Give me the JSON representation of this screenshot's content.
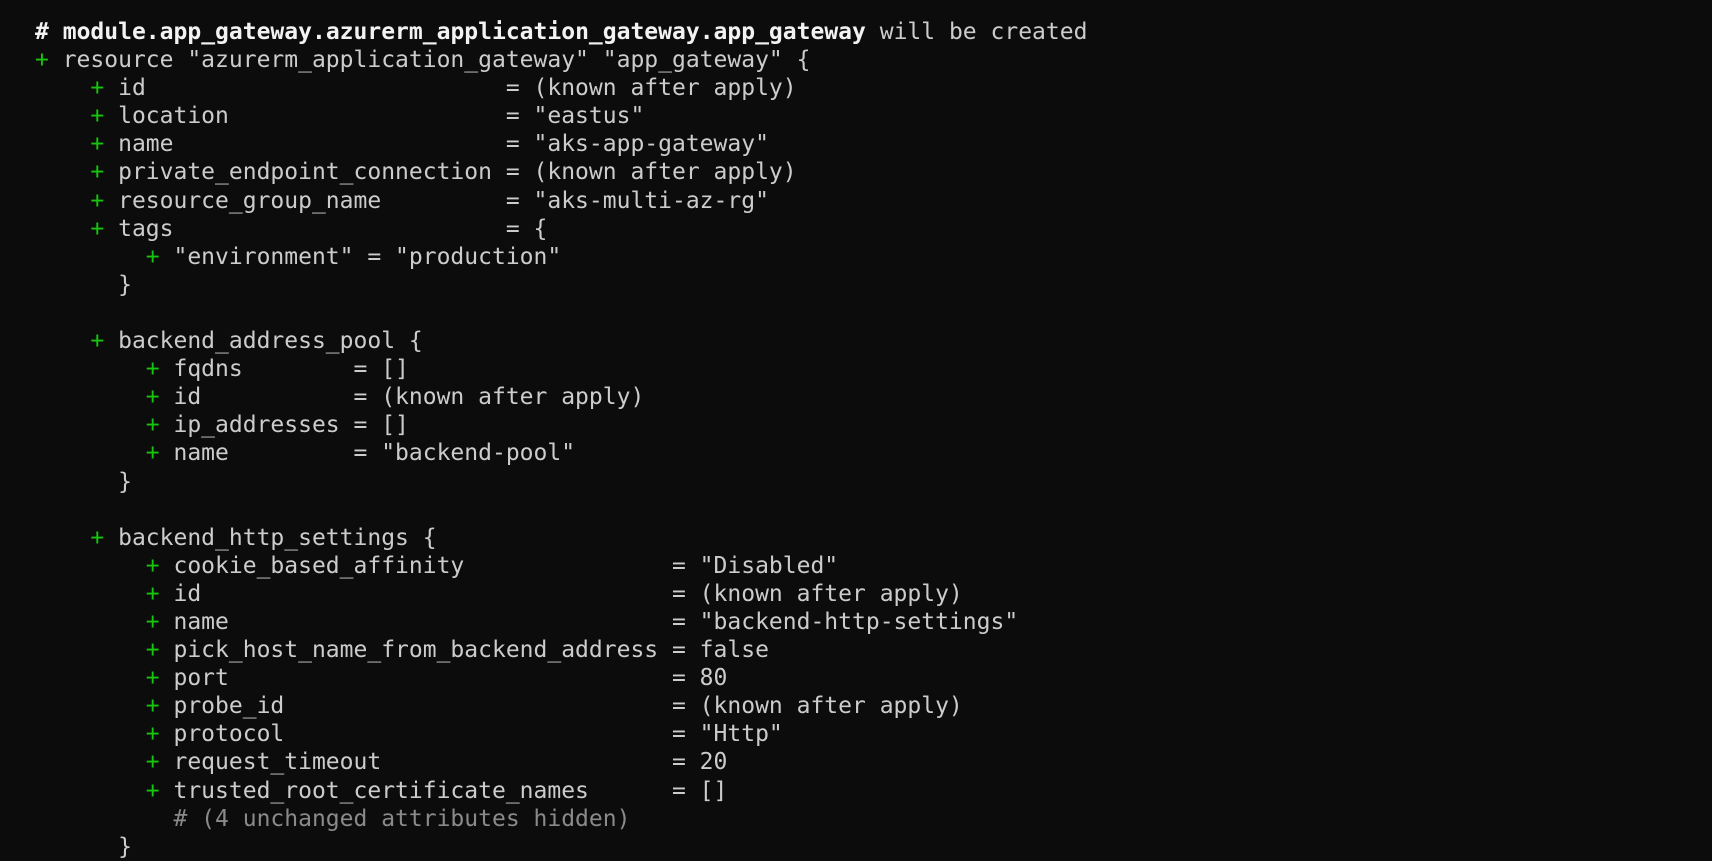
{
  "terminal": {
    "header": {
      "hash": "#",
      "address": "module.app_gateway.azurerm_application_gateway.app_gateway",
      "action": "will be created"
    },
    "lines": [
      {
        "indent": "",
        "plus": "+",
        "text": " resource \"azurerm_application_gateway\" \"app_gateway\" {"
      },
      {
        "indent": "    ",
        "plus": "+",
        "text": " id                          = (known after apply)"
      },
      {
        "indent": "    ",
        "plus": "+",
        "text": " location                    = \"eastus\""
      },
      {
        "indent": "    ",
        "plus": "+",
        "text": " name                        = \"aks-app-gateway\""
      },
      {
        "indent": "    ",
        "plus": "+",
        "text": " private_endpoint_connection = (known after apply)"
      },
      {
        "indent": "    ",
        "plus": "+",
        "text": " resource_group_name         = \"aks-multi-az-rg\""
      },
      {
        "indent": "    ",
        "plus": "+",
        "text": " tags                        = {"
      },
      {
        "indent": "        ",
        "plus": "+",
        "text": " \"environment\" = \"production\""
      },
      {
        "indent": "      ",
        "plus": "",
        "text": "}"
      },
      {
        "indent": "",
        "plus": "",
        "text": ""
      },
      {
        "indent": "    ",
        "plus": "+",
        "text": " backend_address_pool {"
      },
      {
        "indent": "        ",
        "plus": "+",
        "text": " fqdns        = []"
      },
      {
        "indent": "        ",
        "plus": "+",
        "text": " id           = (known after apply)"
      },
      {
        "indent": "        ",
        "plus": "+",
        "text": " ip_addresses = []"
      },
      {
        "indent": "        ",
        "plus": "+",
        "text": " name         = \"backend-pool\""
      },
      {
        "indent": "      ",
        "plus": "",
        "text": "}"
      },
      {
        "indent": "",
        "plus": "",
        "text": ""
      },
      {
        "indent": "    ",
        "plus": "+",
        "text": " backend_http_settings {"
      },
      {
        "indent": "        ",
        "plus": "+",
        "text": " cookie_based_affinity               = \"Disabled\""
      },
      {
        "indent": "        ",
        "plus": "+",
        "text": " id                                  = (known after apply)"
      },
      {
        "indent": "        ",
        "plus": "+",
        "text": " name                                = \"backend-http-settings\""
      },
      {
        "indent": "        ",
        "plus": "+",
        "text": " pick_host_name_from_backend_address = false"
      },
      {
        "indent": "        ",
        "plus": "+",
        "text": " port                                = 80"
      },
      {
        "indent": "        ",
        "plus": "+",
        "text": " probe_id                            = (known after apply)"
      },
      {
        "indent": "        ",
        "plus": "+",
        "text": " protocol                            = \"Http\""
      },
      {
        "indent": "        ",
        "plus": "+",
        "text": " request_timeout                     = 20"
      },
      {
        "indent": "        ",
        "plus": "+",
        "text": " trusted_root_certificate_names      = []"
      },
      {
        "indent": "          ",
        "plus": "",
        "text": "# (4 unchanged attributes hidden)",
        "dim": true
      },
      {
        "indent": "      ",
        "plus": "",
        "text": "}"
      }
    ]
  },
  "colors": {
    "background": "#0c0c0c",
    "text": "#cccccc",
    "plus": "#16c60c",
    "header": "#f2f2f2",
    "comment": "#8a8a8a"
  }
}
